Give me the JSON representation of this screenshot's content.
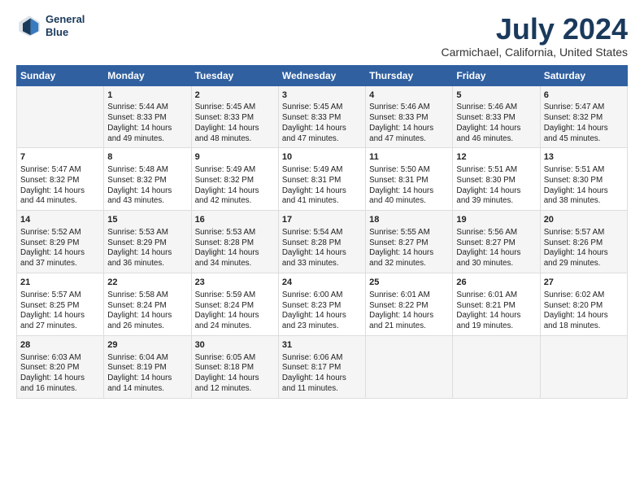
{
  "logo": {
    "line1": "General",
    "line2": "Blue"
  },
  "title": "July 2024",
  "subtitle": "Carmichael, California, United States",
  "header_days": [
    "Sunday",
    "Monday",
    "Tuesday",
    "Wednesday",
    "Thursday",
    "Friday",
    "Saturday"
  ],
  "weeks": [
    [
      {
        "day": "",
        "lines": []
      },
      {
        "day": "1",
        "lines": [
          "Sunrise: 5:44 AM",
          "Sunset: 8:33 PM",
          "Daylight: 14 hours",
          "and 49 minutes."
        ]
      },
      {
        "day": "2",
        "lines": [
          "Sunrise: 5:45 AM",
          "Sunset: 8:33 PM",
          "Daylight: 14 hours",
          "and 48 minutes."
        ]
      },
      {
        "day": "3",
        "lines": [
          "Sunrise: 5:45 AM",
          "Sunset: 8:33 PM",
          "Daylight: 14 hours",
          "and 47 minutes."
        ]
      },
      {
        "day": "4",
        "lines": [
          "Sunrise: 5:46 AM",
          "Sunset: 8:33 PM",
          "Daylight: 14 hours",
          "and 47 minutes."
        ]
      },
      {
        "day": "5",
        "lines": [
          "Sunrise: 5:46 AM",
          "Sunset: 8:33 PM",
          "Daylight: 14 hours",
          "and 46 minutes."
        ]
      },
      {
        "day": "6",
        "lines": [
          "Sunrise: 5:47 AM",
          "Sunset: 8:32 PM",
          "Daylight: 14 hours",
          "and 45 minutes."
        ]
      }
    ],
    [
      {
        "day": "7",
        "lines": [
          "Sunrise: 5:47 AM",
          "Sunset: 8:32 PM",
          "Daylight: 14 hours",
          "and 44 minutes."
        ]
      },
      {
        "day": "8",
        "lines": [
          "Sunrise: 5:48 AM",
          "Sunset: 8:32 PM",
          "Daylight: 14 hours",
          "and 43 minutes."
        ]
      },
      {
        "day": "9",
        "lines": [
          "Sunrise: 5:49 AM",
          "Sunset: 8:32 PM",
          "Daylight: 14 hours",
          "and 42 minutes."
        ]
      },
      {
        "day": "10",
        "lines": [
          "Sunrise: 5:49 AM",
          "Sunset: 8:31 PM",
          "Daylight: 14 hours",
          "and 41 minutes."
        ]
      },
      {
        "day": "11",
        "lines": [
          "Sunrise: 5:50 AM",
          "Sunset: 8:31 PM",
          "Daylight: 14 hours",
          "and 40 minutes."
        ]
      },
      {
        "day": "12",
        "lines": [
          "Sunrise: 5:51 AM",
          "Sunset: 8:30 PM",
          "Daylight: 14 hours",
          "and 39 minutes."
        ]
      },
      {
        "day": "13",
        "lines": [
          "Sunrise: 5:51 AM",
          "Sunset: 8:30 PM",
          "Daylight: 14 hours",
          "and 38 minutes."
        ]
      }
    ],
    [
      {
        "day": "14",
        "lines": [
          "Sunrise: 5:52 AM",
          "Sunset: 8:29 PM",
          "Daylight: 14 hours",
          "and 37 minutes."
        ]
      },
      {
        "day": "15",
        "lines": [
          "Sunrise: 5:53 AM",
          "Sunset: 8:29 PM",
          "Daylight: 14 hours",
          "and 36 minutes."
        ]
      },
      {
        "day": "16",
        "lines": [
          "Sunrise: 5:53 AM",
          "Sunset: 8:28 PM",
          "Daylight: 14 hours",
          "and 34 minutes."
        ]
      },
      {
        "day": "17",
        "lines": [
          "Sunrise: 5:54 AM",
          "Sunset: 8:28 PM",
          "Daylight: 14 hours",
          "and 33 minutes."
        ]
      },
      {
        "day": "18",
        "lines": [
          "Sunrise: 5:55 AM",
          "Sunset: 8:27 PM",
          "Daylight: 14 hours",
          "and 32 minutes."
        ]
      },
      {
        "day": "19",
        "lines": [
          "Sunrise: 5:56 AM",
          "Sunset: 8:27 PM",
          "Daylight: 14 hours",
          "and 30 minutes."
        ]
      },
      {
        "day": "20",
        "lines": [
          "Sunrise: 5:57 AM",
          "Sunset: 8:26 PM",
          "Daylight: 14 hours",
          "and 29 minutes."
        ]
      }
    ],
    [
      {
        "day": "21",
        "lines": [
          "Sunrise: 5:57 AM",
          "Sunset: 8:25 PM",
          "Daylight: 14 hours",
          "and 27 minutes."
        ]
      },
      {
        "day": "22",
        "lines": [
          "Sunrise: 5:58 AM",
          "Sunset: 8:24 PM",
          "Daylight: 14 hours",
          "and 26 minutes."
        ]
      },
      {
        "day": "23",
        "lines": [
          "Sunrise: 5:59 AM",
          "Sunset: 8:24 PM",
          "Daylight: 14 hours",
          "and 24 minutes."
        ]
      },
      {
        "day": "24",
        "lines": [
          "Sunrise: 6:00 AM",
          "Sunset: 8:23 PM",
          "Daylight: 14 hours",
          "and 23 minutes."
        ]
      },
      {
        "day": "25",
        "lines": [
          "Sunrise: 6:01 AM",
          "Sunset: 8:22 PM",
          "Daylight: 14 hours",
          "and 21 minutes."
        ]
      },
      {
        "day": "26",
        "lines": [
          "Sunrise: 6:01 AM",
          "Sunset: 8:21 PM",
          "Daylight: 14 hours",
          "and 19 minutes."
        ]
      },
      {
        "day": "27",
        "lines": [
          "Sunrise: 6:02 AM",
          "Sunset: 8:20 PM",
          "Daylight: 14 hours",
          "and 18 minutes."
        ]
      }
    ],
    [
      {
        "day": "28",
        "lines": [
          "Sunrise: 6:03 AM",
          "Sunset: 8:20 PM",
          "Daylight: 14 hours",
          "and 16 minutes."
        ]
      },
      {
        "day": "29",
        "lines": [
          "Sunrise: 6:04 AM",
          "Sunset: 8:19 PM",
          "Daylight: 14 hours",
          "and 14 minutes."
        ]
      },
      {
        "day": "30",
        "lines": [
          "Sunrise: 6:05 AM",
          "Sunset: 8:18 PM",
          "Daylight: 14 hours",
          "and 12 minutes."
        ]
      },
      {
        "day": "31",
        "lines": [
          "Sunrise: 6:06 AM",
          "Sunset: 8:17 PM",
          "Daylight: 14 hours",
          "and 11 minutes."
        ]
      },
      {
        "day": "",
        "lines": []
      },
      {
        "day": "",
        "lines": []
      },
      {
        "day": "",
        "lines": []
      }
    ]
  ]
}
